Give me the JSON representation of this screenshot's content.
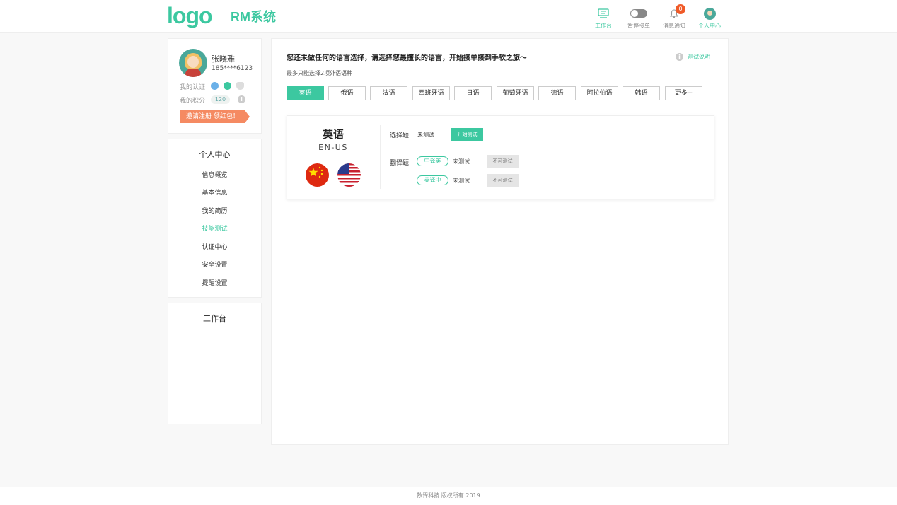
{
  "header": {
    "logo": "logo",
    "system_name": "RM系统",
    "nav": [
      {
        "label": "工作台",
        "icon": "monitor-icon",
        "active": true
      },
      {
        "label": "暂停接单",
        "icon": "toggle-icon"
      },
      {
        "label": "消息通知",
        "icon": "bell-icon",
        "badge": "0"
      },
      {
        "label": "个人中心",
        "icon": "avatar-icon"
      }
    ]
  },
  "profile": {
    "name": "张晓雅",
    "phone": "185****6123",
    "cert_label": "我的认证",
    "points_label": "我的积分",
    "points": "120",
    "invite": "邀请注册 领红包！"
  },
  "menu": {
    "title": "个人中心",
    "items": [
      "信息概览",
      "基本信息",
      "我的简历",
      "技能测试",
      "认证中心",
      "安全设置",
      "提醒设置"
    ],
    "active_index": 3
  },
  "workbench": {
    "title": "工作台"
  },
  "main": {
    "title": "您还未做任何的语言选择，请选择您最擅长的语言，开始接单接到手软之旅～",
    "subtitle": "最多只能选择2项外语语种",
    "help_link": "测试说明",
    "languages": [
      "英语",
      "俄语",
      "法语",
      "西班牙语",
      "日语",
      "葡萄牙语",
      "德语",
      "阿拉伯语",
      "韩语",
      "更多+"
    ],
    "selected": "英语",
    "test": {
      "lang_name": "英语",
      "lang_code": "EN-US",
      "choice_label": "选择题",
      "choice_status": "未测试",
      "start_button": "开始测试",
      "translate_label": "翻译题",
      "zh_en": "中译英",
      "en_zh": "英译中",
      "zh_en_status": "未测试",
      "en_zh_status": "未测试",
      "disabled_button": "不可测试"
    }
  },
  "footer": "数译科技 版权所有 2019",
  "colors": {
    "accent": "#3cc8a0",
    "badge": "#f05a28",
    "invite": "#f58a62"
  }
}
